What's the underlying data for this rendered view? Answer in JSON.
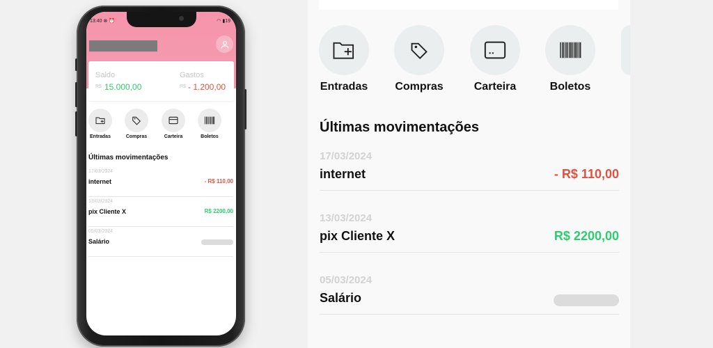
{
  "phone": {
    "status_time": "13:40",
    "status_battery": "19",
    "summary": {
      "saldo_label": "Saldo",
      "saldo_currency": "R$",
      "saldo_value": "15.000,00",
      "gastos_label": "Gastos",
      "gastos_currency": "R$",
      "gastos_value": "- 1.200,00"
    }
  },
  "actions": [
    {
      "label": "Entradas",
      "icon": "folder-plus-icon"
    },
    {
      "label": "Compras",
      "icon": "tag-icon"
    },
    {
      "label": "Carteira",
      "icon": "card-icon"
    },
    {
      "label": "Boletos",
      "icon": "barcode-icon"
    }
  ],
  "transactions_title": "Últimas movimentações",
  "transactions": [
    {
      "date": "17/03/2024",
      "name": "internet",
      "value": "- R$ 110,00",
      "type": "negative"
    },
    {
      "date": "13/03/2024",
      "name": "pix Cliente X",
      "value": "R$ 2200,00",
      "type": "positive"
    },
    {
      "date": "05/03/2024",
      "name": "Salário",
      "value": "",
      "type": "hidden"
    }
  ],
  "colors": {
    "brand_pink": "#f694ab",
    "negative": "#e0523f",
    "positive": "#2fcc71"
  }
}
